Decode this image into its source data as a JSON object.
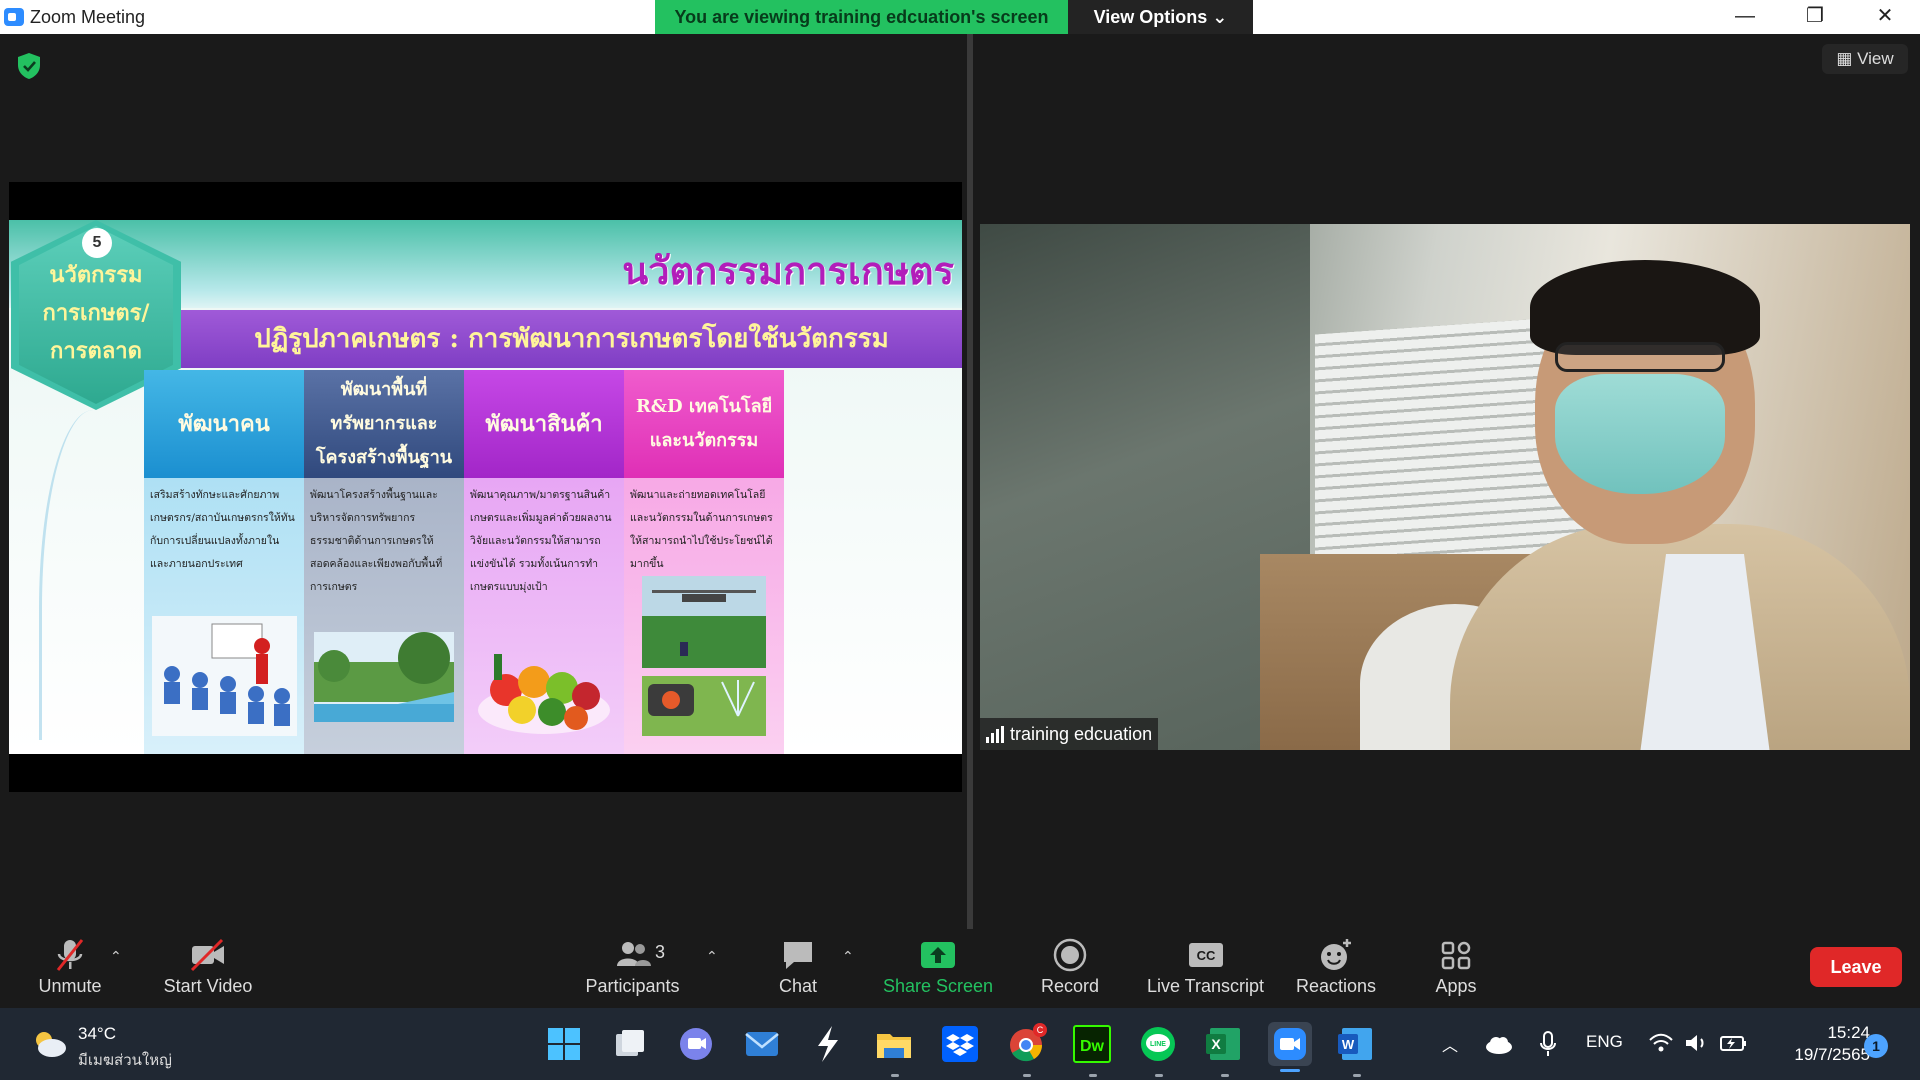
{
  "window": {
    "title": "Zoom Meeting",
    "viewing_banner": "You are viewing training edcuation's screen",
    "view_options": "View Options ⌄",
    "minimize": "—",
    "restore": "❐",
    "close": "✕"
  },
  "meeting": {
    "view_button": "View"
  },
  "slide": {
    "title": "นวัตกรรมการเกษตร",
    "banner": "ปฏิรูปภาคเกษตร : การพัฒนาการเกษตรโดยใช้นวัตกรรม",
    "hex_number": "5",
    "hex_line1": "นวัตกรรม",
    "hex_line2": "การเกษตร/",
    "hex_line3": "การตลาด",
    "columns": [
      {
        "head": "พัฒนาคน",
        "body": "เสริมสร้างทักษะและศักยภาพเกษตรกร/สถาบันเกษตรกรให้ทันกับการเปลี่ยนแปลงทั้งภายในและภายนอกประเทศ"
      },
      {
        "head": "พัฒนาพื้นที่ ทรัพยากรและโครงสร้างพื้นฐาน",
        "body": "พัฒนาโครงสร้างพื้นฐานและบริหารจัดการทรัพยากร ธรรมชาติด้านการเกษตรให้สอดคล้องและเพียงพอกับพื้นที่การเกษตร"
      },
      {
        "head": "พัฒนาสินค้า",
        "body": "พัฒนาคุณภาพ/มาตรฐานสินค้าเกษตรและเพิ่มมูลค่าด้วยผลงานวิจัยและนวัตกรรมให้สามารถแข่งขันได้ รวมทั้งเน้นการทำเกษตรแบบมุ่งเป้า"
      },
      {
        "head": "R&D เทคโนโลยีและนวัตกรรม",
        "body": "พัฒนาและถ่ายทอดเทคโนโลยีและนวัตกรรมในด้านการเกษตรให้สามารถนำไปใช้ประโยชน์ได้มากขึ้น"
      }
    ]
  },
  "video": {
    "participant_name": "training edcuation"
  },
  "toolbar": {
    "unmute": "Unmute",
    "start_video": "Start Video",
    "participants": "Participants",
    "participants_count": "3",
    "chat": "Chat",
    "share_screen": "Share Screen",
    "record": "Record",
    "live_transcript": "Live Transcript",
    "reactions": "Reactions",
    "apps": "Apps",
    "leave": "Leave",
    "caret": "⌃",
    "cc_text": "CC"
  },
  "taskbar": {
    "temperature": "34°C",
    "location": "มีเมฆส่วนใหญ่",
    "language": "ENG",
    "time": "15:24",
    "date": "19/7/2565",
    "notifications": "1",
    "chrome_badge": "C",
    "dw_label": "Dw",
    "line_label": "LINE",
    "excel_label": "X",
    "word_label": "W"
  },
  "colors": {
    "banner_green": "#23c160",
    "share_green": "#23c160",
    "leave_red": "#e02828",
    "zoom_blue": "#2d8cff"
  }
}
